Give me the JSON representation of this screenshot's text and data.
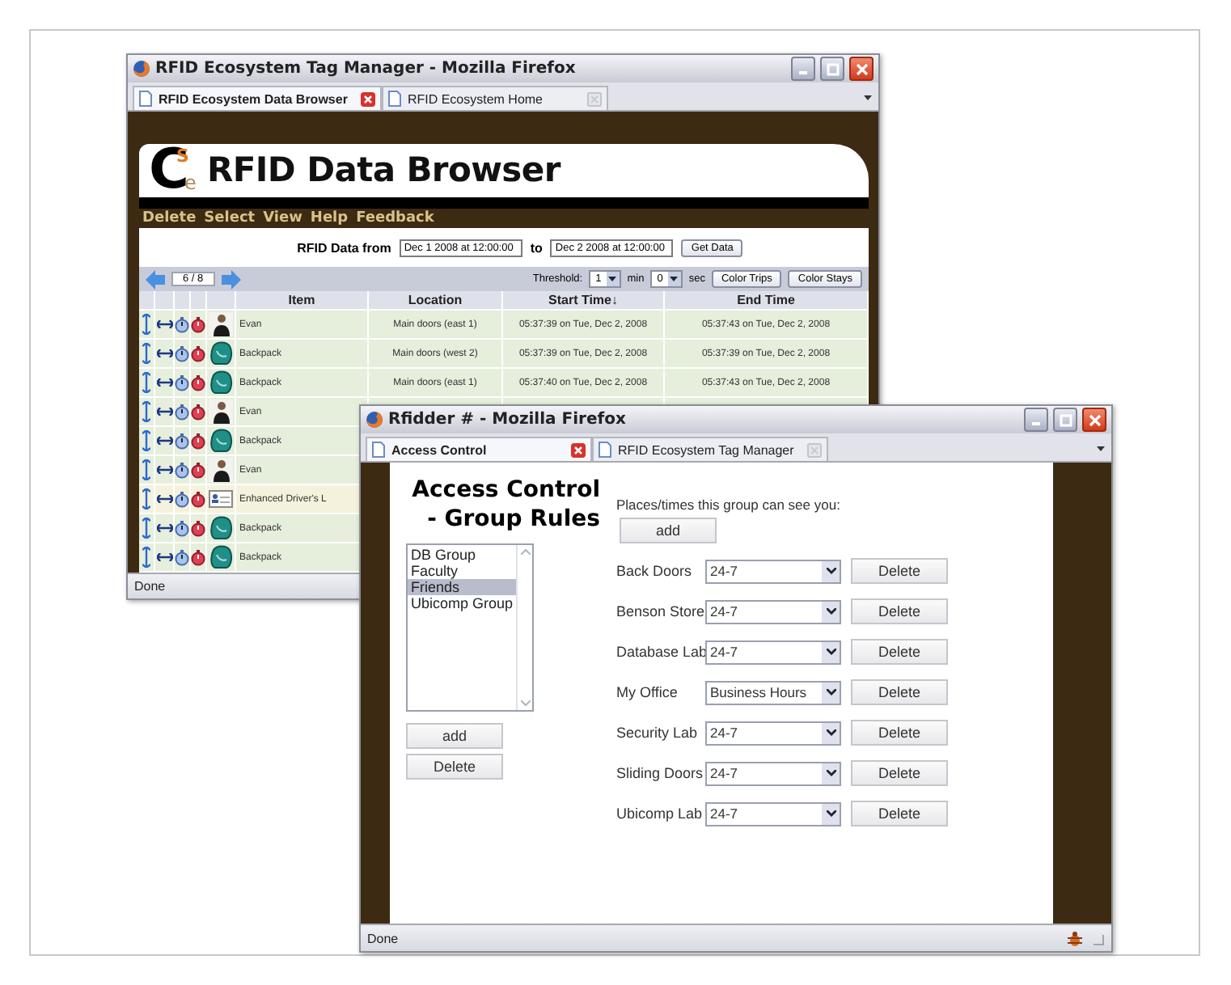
{
  "back_window": {
    "title": "RFID Ecosystem Tag Manager - Mozilla Firefox",
    "tabs": [
      {
        "label": "RFID Ecosystem Data Browser",
        "selected": true
      },
      {
        "label": "RFID Ecosystem Home",
        "selected": false
      }
    ],
    "logo": {
      "letters": [
        "C",
        "S",
        "e"
      ]
    },
    "heading": "RFID Data Browser",
    "menu": [
      "Delete",
      "Select",
      "View",
      "Help",
      "Feedback"
    ],
    "range": {
      "label": "RFID Data from",
      "from": "Dec 1 2008 at 12:00:00",
      "to_label": "to",
      "to": "Dec 2 2008 at 12:00:00",
      "button": "Get Data"
    },
    "pager": {
      "page": "6 / 8"
    },
    "threshold": {
      "label": "Threshold:",
      "minutes": "1",
      "min_label": "min",
      "seconds": "0",
      "sec_label": "sec"
    },
    "buttons": [
      "Color Trips",
      "Color Stays"
    ],
    "table": {
      "columns": [
        {
          "label": "Item"
        },
        {
          "label": "Location"
        },
        {
          "label": "Start Time",
          "sort_mark": "↓"
        },
        {
          "label": "End Time"
        }
      ],
      "rows": [
        {
          "kind": "person",
          "item": "Evan",
          "location": "Main doors (east 1)",
          "start": "05:37:39 on Tue, Dec 2, 2008",
          "end": "05:37:43 on Tue, Dec 2, 2008"
        },
        {
          "kind": "bag",
          "item": "Backpack",
          "location": "Main doors (west 2)",
          "start": "05:37:39 on Tue, Dec 2, 2008",
          "end": "05:37:39 on Tue, Dec 2, 2008"
        },
        {
          "kind": "bag",
          "item": "Backpack",
          "location": "Main doors (east 1)",
          "start": "05:37:40 on Tue, Dec 2, 2008",
          "end": "05:37:43 on Tue, Dec 2, 2008"
        },
        {
          "kind": "person",
          "item": "Evan"
        },
        {
          "kind": "bag",
          "item": "Backpack"
        },
        {
          "kind": "person",
          "item": "Evan"
        },
        {
          "kind": "card",
          "item": "Enhanced Driver's L"
        },
        {
          "kind": "bag",
          "item": "Backpack"
        },
        {
          "kind": "bag",
          "item": "Backpack"
        }
      ]
    },
    "status": "Done"
  },
  "front_window": {
    "title": "Rfidder # - Mozilla Firefox",
    "tabs": [
      {
        "label": "Access Control",
        "selected": true
      },
      {
        "label": "RFID Ecosystem Tag Manager",
        "selected": false
      }
    ],
    "heading": [
      "Access Control",
      "- Group Rules"
    ],
    "groups": [
      {
        "label": "DB Group",
        "selected": false
      },
      {
        "label": "Faculty",
        "selected": false
      },
      {
        "label": "Friends",
        "selected": true
      },
      {
        "label": "Ubicomp Group",
        "selected": false
      }
    ],
    "group_buttons": [
      "add",
      "Delete"
    ],
    "places_label": "Places/times this group can see you:",
    "add_button": "add",
    "rules": [
      {
        "place": "Back Doors",
        "schedule": "24-7",
        "button": "Delete"
      },
      {
        "place": "Benson Store",
        "schedule": "24-7",
        "button": "Delete"
      },
      {
        "place": "Database Lab",
        "schedule": "24-7",
        "button": "Delete"
      },
      {
        "place": "My Office",
        "schedule": "Business Hours",
        "button": "Delete"
      },
      {
        "place": "Security Lab",
        "schedule": "24-7",
        "button": "Delete"
      },
      {
        "place": "Sliding Doors",
        "schedule": "24-7",
        "button": "Delete"
      },
      {
        "place": "Ubicomp Lab",
        "schedule": "24-7",
        "button": "Delete"
      }
    ],
    "status": "Done"
  }
}
